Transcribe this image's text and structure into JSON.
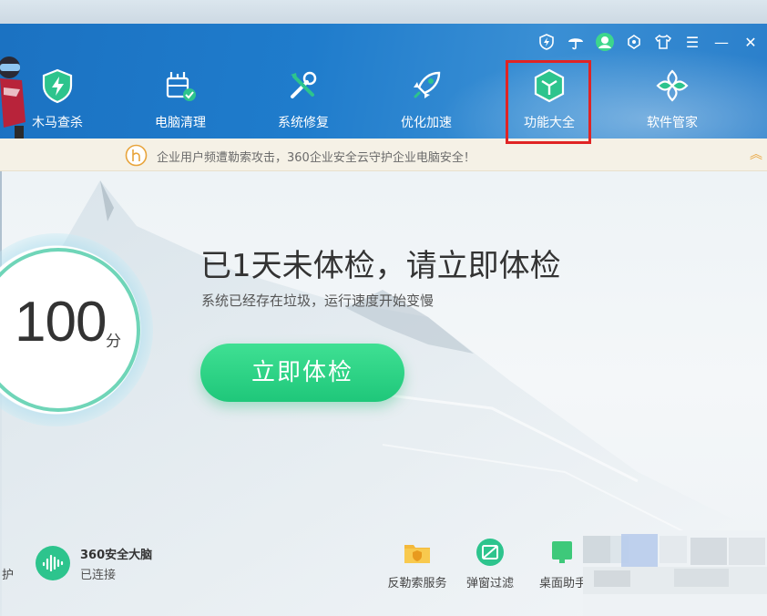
{
  "window": {
    "controls": [
      {
        "name": "shield-bolt-icon"
      },
      {
        "name": "umbrella-icon"
      },
      {
        "name": "avatar-icon"
      },
      {
        "name": "sync-icon"
      },
      {
        "name": "shirt-icon"
      },
      {
        "name": "menu-icon",
        "glyph": "☰"
      },
      {
        "name": "minimize-icon",
        "glyph": "—"
      },
      {
        "name": "close-icon",
        "glyph": "✕"
      }
    ]
  },
  "nav": {
    "items": [
      {
        "label": "木马查杀",
        "icon": "shield-bolt-icon"
      },
      {
        "label": "电脑清理",
        "icon": "broom-icon"
      },
      {
        "label": "系统修复",
        "icon": "wrench-icon"
      },
      {
        "label": "优化加速",
        "icon": "rocket-icon"
      },
      {
        "label": "功能大全",
        "icon": "cube-icon"
      },
      {
        "label": "软件管家",
        "icon": "apps-icon"
      }
    ],
    "highlighted": "功能大全"
  },
  "notice": {
    "text": "企业用户频遭勒索攻击，360企业安全云守护企业电脑安全！"
  },
  "score": {
    "value": "100",
    "unit": "分"
  },
  "main": {
    "headline": "已1天未体检，请立即体检",
    "subline": "系统已经存在垃圾，运行速度开始变慢",
    "check_button": "立即体检"
  },
  "bottom": {
    "left_cut_label": "护",
    "brain_title": "360安全大脑",
    "brain_status": "已连接",
    "tools": [
      {
        "label": "反勒索服务",
        "icon": "folder-shield-icon"
      },
      {
        "label": "弹窗过滤",
        "icon": "popup-block-icon"
      },
      {
        "label": "桌面助手",
        "icon": "desktop-assistant-icon"
      }
    ]
  },
  "colors": {
    "header_blue": "#1f7ccc",
    "accent_green": "#1fc77a",
    "highlight_red": "#e02424"
  }
}
